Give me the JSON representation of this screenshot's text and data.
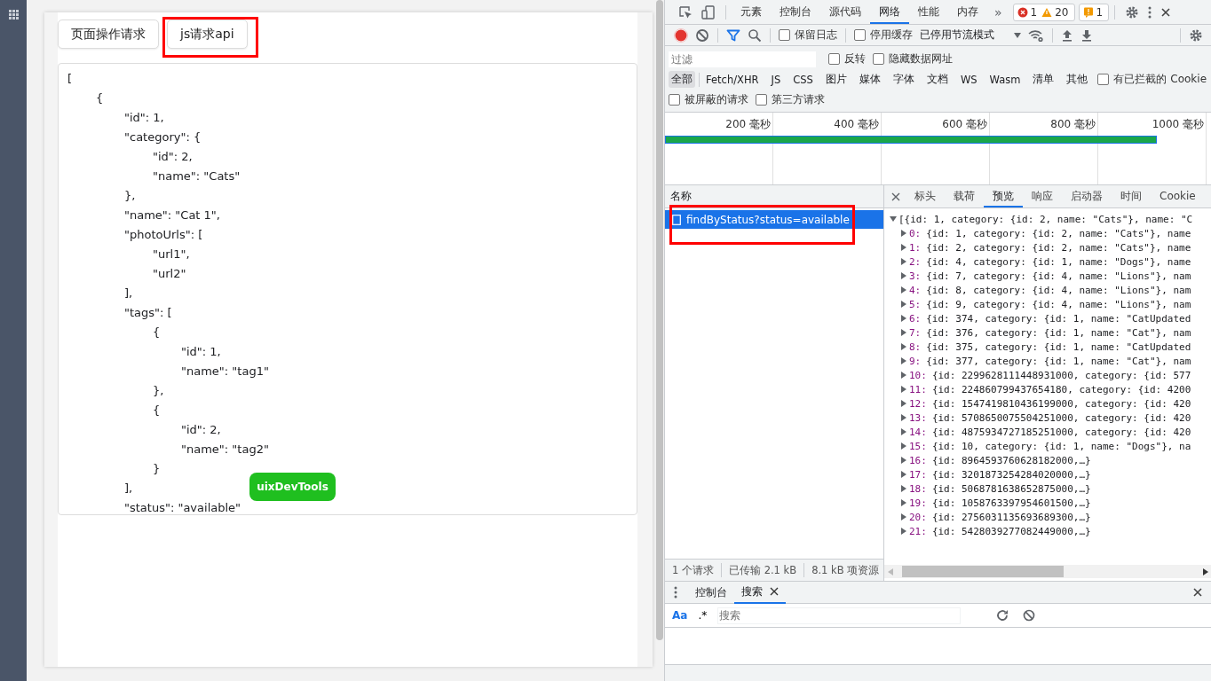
{
  "page": {
    "buttons": [
      {
        "label": "页面操作请求",
        "highlighted": false
      },
      {
        "label": "js请求api",
        "highlighted": true
      }
    ],
    "code_lines": [
      {
        "text": "[",
        "children": [
          {
            "text": "{",
            "children": [
              {
                "text": "\"id\": 1,"
              },
              {
                "text": "\"category\": {",
                "children": [
                  {
                    "text": "\"id\": 2,"
                  },
                  {
                    "text": "\"name\": \"Cats\""
                  }
                ]
              },
              {
                "text": "},"
              },
              {
                "text": "\"name\": \"Cat 1\","
              },
              {
                "text": "\"photoUrls\": [",
                "children": [
                  {
                    "text": "\"url1\","
                  },
                  {
                    "text": "\"url2\""
                  }
                ]
              },
              {
                "text": "],"
              },
              {
                "text": "\"tags\": [",
                "children": [
                  {
                    "text": "{",
                    "children": [
                      {
                        "text": "\"id\": 1,"
                      },
                      {
                        "text": "\"name\": \"tag1\""
                      }
                    ]
                  },
                  {
                    "text": "},"
                  },
                  {
                    "text": "{",
                    "children": [
                      {
                        "text": "\"id\": 2,"
                      },
                      {
                        "text": "\"name\": \"tag2\""
                      }
                    ]
                  },
                  {
                    "text": "}"
                  }
                ]
              },
              {
                "text": "],"
              },
              {
                "text": "\"status\": \"available\""
              }
            ]
          }
        ]
      }
    ],
    "overlay_button": "uixDevTools"
  },
  "devtools": {
    "panel_tabs": [
      {
        "label": "元素",
        "selected": false
      },
      {
        "label": "控制台",
        "selected": false
      },
      {
        "label": "源代码",
        "selected": false
      },
      {
        "label": "网络",
        "selected": true
      },
      {
        "label": "性能",
        "selected": false
      },
      {
        "label": "内存",
        "selected": false
      }
    ],
    "more": "»",
    "counters": [
      {
        "kind": "error",
        "count": "1"
      },
      {
        "kind": "warning",
        "count": "20"
      },
      {
        "kind": "issue",
        "count": "1"
      }
    ],
    "toolbar": {
      "recording": true,
      "options": [
        {
          "label": "保留日志",
          "checked": false
        },
        {
          "label": "停用缓存",
          "checked": false
        }
      ],
      "throttling": "已停用节流模式"
    },
    "filter": {
      "placeholder": "过滤",
      "options": [
        {
          "label": "反转",
          "checked": false
        },
        {
          "label": "隐藏数据网址",
          "checked": false
        }
      ]
    },
    "type_filters": [
      {
        "label": "全部",
        "selected": true
      },
      {
        "label": "Fetch/XHR",
        "selected": false
      },
      {
        "label": "JS",
        "selected": false
      },
      {
        "label": "CSS",
        "selected": false
      },
      {
        "label": "图片",
        "selected": false
      },
      {
        "label": "媒体",
        "selected": false
      },
      {
        "label": "字体",
        "selected": false
      },
      {
        "label": "文档",
        "selected": false
      },
      {
        "label": "WS",
        "selected": false
      },
      {
        "label": "Wasm",
        "selected": false
      },
      {
        "label": "清单",
        "selected": false
      },
      {
        "label": "其他",
        "selected": false
      }
    ],
    "blocked_cookies": {
      "label": "有已拦截的 Cookie",
      "checked": false
    },
    "extra_filters": [
      {
        "label": "被屏蔽的请求",
        "checked": false
      },
      {
        "label": "第三方请求",
        "checked": false
      }
    ],
    "timeline_ticks": [
      "200 毫秒",
      "400 毫秒",
      "600 毫秒",
      "800 毫秒",
      "1000 毫秒"
    ],
    "requests": {
      "column": "名称",
      "rows": [
        {
          "name": "findByStatus?status=available",
          "selected": true,
          "highlighted": true
        }
      ]
    },
    "summary": [
      "1 个请求",
      "已传输 2.1 kB",
      "8.1 kB 项资源"
    ],
    "detail_tabs": [
      {
        "label": "标头",
        "selected": false
      },
      {
        "label": "载荷",
        "selected": false
      },
      {
        "label": "预览",
        "selected": true
      },
      {
        "label": "响应",
        "selected": false
      },
      {
        "label": "启动器",
        "selected": false
      },
      {
        "label": "时间",
        "selected": false
      },
      {
        "label": "Cookie",
        "selected": false
      }
    ],
    "preview": {
      "text": "[{id: 1, category: {id: 2, name: \"Cats\"}, name: \"C",
      "expanded": true,
      "children": [
        {
          "key": "0:",
          "text": "{id: 1, category: {id: 2, name: \"Cats\"}, name",
          "expanded": false
        },
        {
          "key": "1:",
          "text": "{id: 2, category: {id: 2, name: \"Cats\"}, name",
          "expanded": false
        },
        {
          "key": "2:",
          "text": "{id: 4, category: {id: 1, name: \"Dogs\"}, name",
          "expanded": false
        },
        {
          "key": "3:",
          "text": "{id: 7, category: {id: 4, name: \"Lions\"}, nam",
          "expanded": false
        },
        {
          "key": "4:",
          "text": "{id: 8, category: {id: 4, name: \"Lions\"}, nam",
          "expanded": false
        },
        {
          "key": "5:",
          "text": "{id: 9, category: {id: 4, name: \"Lions\"}, nam",
          "expanded": false
        },
        {
          "key": "6:",
          "text": "{id: 374, category: {id: 1, name: \"CatUpdated",
          "expanded": false
        },
        {
          "key": "7:",
          "text": "{id: 376, category: {id: 1, name: \"Cat\"}, nam",
          "expanded": false
        },
        {
          "key": "8:",
          "text": "{id: 375, category: {id: 1, name: \"CatUpdated",
          "expanded": false
        },
        {
          "key": "9:",
          "text": "{id: 377, category: {id: 1, name: \"Cat\"}, nam",
          "expanded": false
        },
        {
          "key": "10:",
          "text": "{id: 2299628111448931000, category: {id: 577",
          "expanded": false
        },
        {
          "key": "11:",
          "text": "{id: 224860799437654180, category: {id: 4200",
          "expanded": false
        },
        {
          "key": "12:",
          "text": "{id: 1547419810436199000, category: {id: 420",
          "expanded": false
        },
        {
          "key": "13:",
          "text": "{id: 5708650075504251000, category: {id: 420",
          "expanded": false
        },
        {
          "key": "14:",
          "text": "{id: 4875934727185251000, category: {id: 420",
          "expanded": false
        },
        {
          "key": "15:",
          "text": "{id: 10, category: {id: 1, name: \"Dogs\"}, na",
          "expanded": false
        },
        {
          "key": "16:",
          "text": "{id: 8964593760628182000,…}",
          "expanded": false
        },
        {
          "key": "17:",
          "text": "{id: 3201873254284020000,…}",
          "expanded": false
        },
        {
          "key": "18:",
          "text": "{id: 5068781638652875000,…}",
          "expanded": false
        },
        {
          "key": "19:",
          "text": "{id: 1058763397954601500,…}",
          "expanded": false
        },
        {
          "key": "20:",
          "text": "{id: 2756031135693689300,…}",
          "expanded": false
        },
        {
          "key": "21:",
          "text": "{id: 5428039277082449000,…}",
          "expanded": false
        }
      ]
    },
    "drawer": {
      "tabs": [
        {
          "label": "控制台",
          "selected": false,
          "closable": false
        },
        {
          "label": "搜索",
          "selected": true,
          "closable": true
        }
      ],
      "search": {
        "case_label": "Aa",
        "regex_label": ".*",
        "placeholder": "搜索"
      }
    }
  }
}
